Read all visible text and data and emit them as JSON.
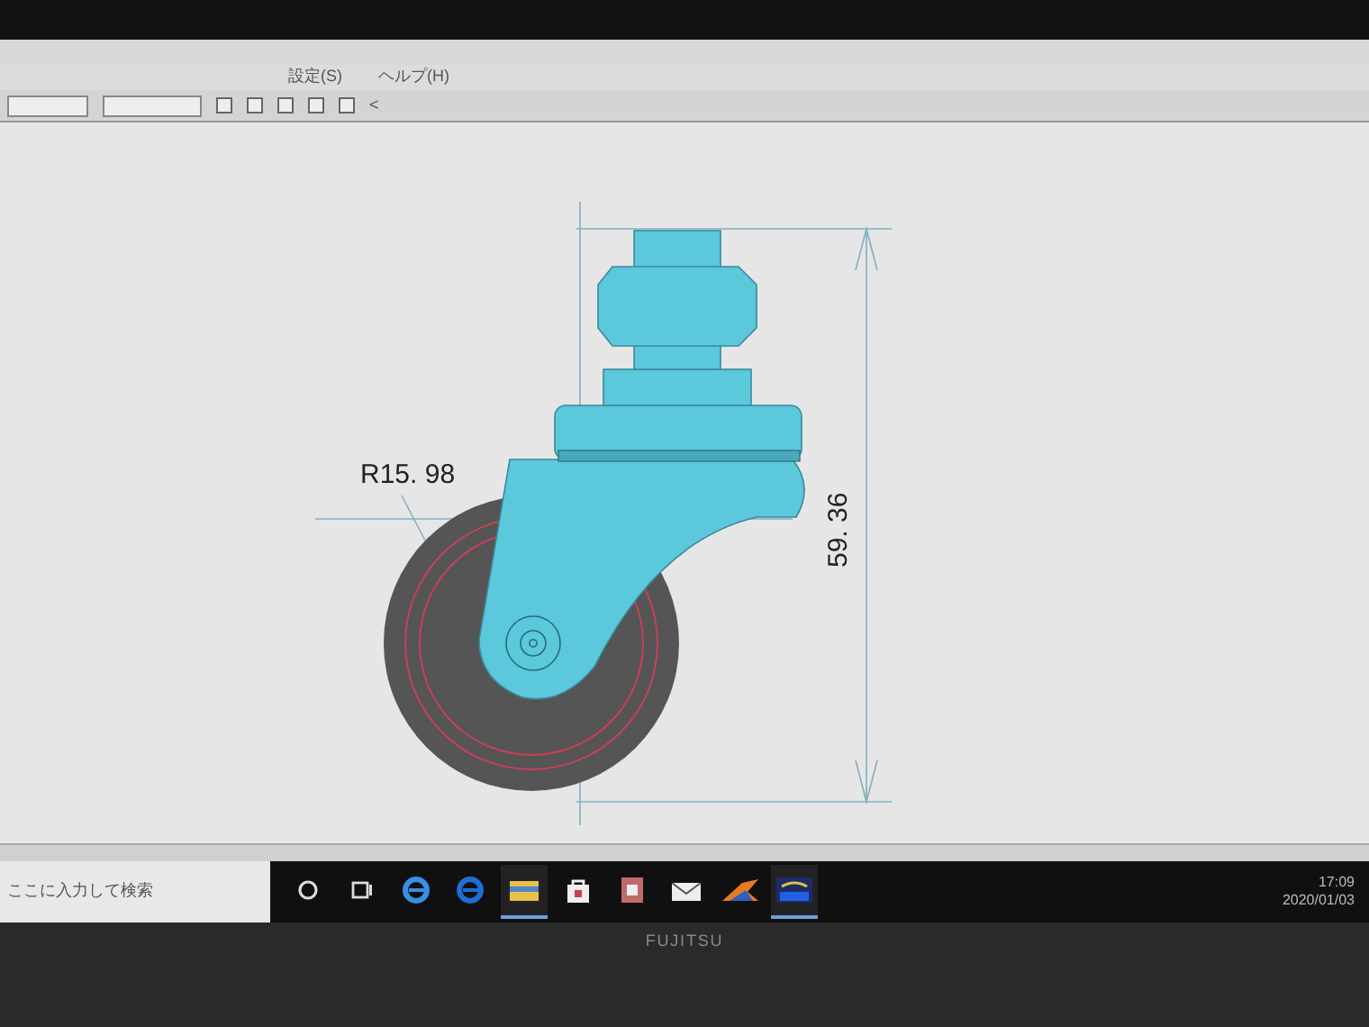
{
  "menu": {
    "items": [
      "設定(S)",
      "ヘルプ(H)"
    ]
  },
  "toolbar": {
    "checkboxes": [
      {
        "checked": false
      },
      {
        "checked": false
      },
      {
        "checked": false
      },
      {
        "checked": false
      },
      {
        "checked": false
      }
    ],
    "last_label": "<"
  },
  "drawing": {
    "radius_label": "R15. 98",
    "height_label": "59. 36"
  },
  "taskbar": {
    "search": {
      "placeholder": "ここに入力して検索"
    },
    "apps": [
      {
        "kind": "cortana",
        "selected": false
      },
      {
        "kind": "taskview",
        "selected": false
      },
      {
        "kind": "edge-old",
        "selected": false
      },
      {
        "kind": "edge",
        "selected": false
      },
      {
        "kind": "folder",
        "selected": true
      },
      {
        "kind": "store",
        "selected": false
      },
      {
        "kind": "media",
        "selected": false
      },
      {
        "kind": "mail",
        "selected": false
      },
      {
        "kind": "cad",
        "selected": false
      },
      {
        "kind": "jww",
        "selected": true
      }
    ],
    "time": "17:09",
    "date": "2020/01/03"
  },
  "monitor": {
    "brand": "FUJITSU"
  }
}
